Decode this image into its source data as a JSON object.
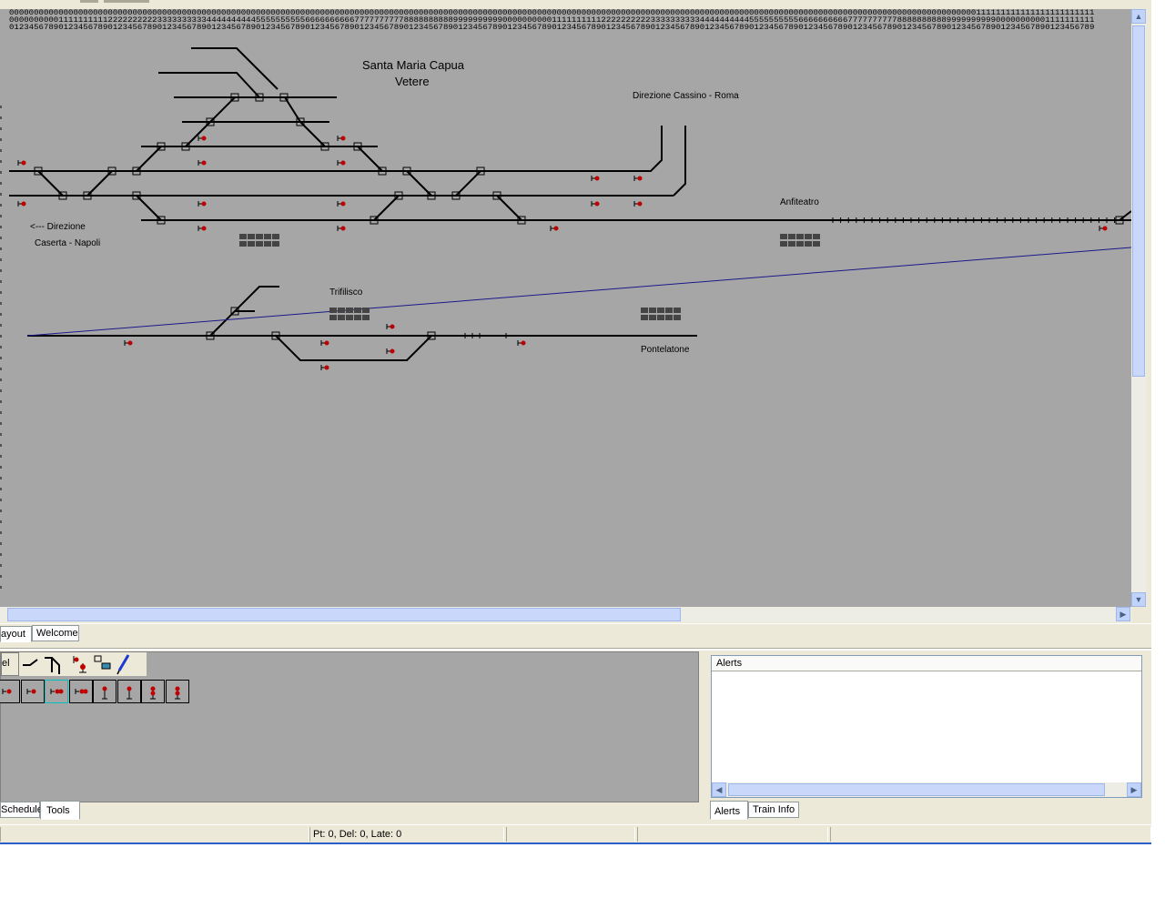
{
  "layout": {
    "title_line1": "Santa Maria Capua",
    "title_line2": "Vetere",
    "label_cassino": "Direzione Cassino - Roma",
    "label_anfiteatro": "Anfiteatro",
    "label_direzione": "<--- Direzione",
    "label_caserta": "Caserta - Napoli",
    "label_trifilisco": "Trifilisco",
    "label_pontelatone": "Pontelatone"
  },
  "ruler": {
    "hundreds": "00000000000000000000000000000000000000000000000000000000000000000000000000000000000000000000000000000000000000000000000000000000000000000000000000000000000000000000000000000000000000000000000000001111111111111111111111111111111111111111111111111111111111111111111111111111111111111111111111111111111",
    "tens": "0000000000111111111122222222223333333333444444444455555555556666666666777777777788888888889999999999000000000011111111112222222222333333333344444444445555555555666666666677777777778888888888999999999900000000001111111111222222222233333333334444444444555555555566666666667777777777888888888899999999990000000000111111111122222222223333333333",
    "ones": "0123456789012345678901234567890123456789012345678901234567890123456789012345678901234567890123456789012345678901234567890123456789012345678901234567890123456789012345678901234567890123456789012345678901234567890123456789"
  },
  "tabs_top": [
    {
      "label": "ayout"
    },
    {
      "label": "Welcome"
    }
  ],
  "tools": {
    "row1_label": "el",
    "row1_icons": [
      "straight-track-icon",
      "point-track-icon",
      "junction-track-icon",
      "signal-icon",
      "location-icon",
      "pencil-icon"
    ],
    "row2_icons": [
      "signal-1-icon",
      "signal-2-icon",
      "signal-3-icon",
      "signal-4-icon",
      "signal-5-icon",
      "signal-6-icon",
      "signal-7-icon",
      "signal-8-icon"
    ]
  },
  "tabs_bottom_left": [
    {
      "label": "Schedule"
    },
    {
      "label": "Tools"
    }
  ],
  "alerts": {
    "header": "Alerts"
  },
  "tabs_bottom_right": [
    {
      "label": "Alerts"
    },
    {
      "label": "Train Info"
    }
  ],
  "status": {
    "counts": "Pt:   0, Del:   0, Late:   0"
  },
  "colors": {
    "canvas": "#a6a6a6",
    "track": "#000000",
    "signal": "#c00000",
    "route_line": "#1a1a8a"
  }
}
